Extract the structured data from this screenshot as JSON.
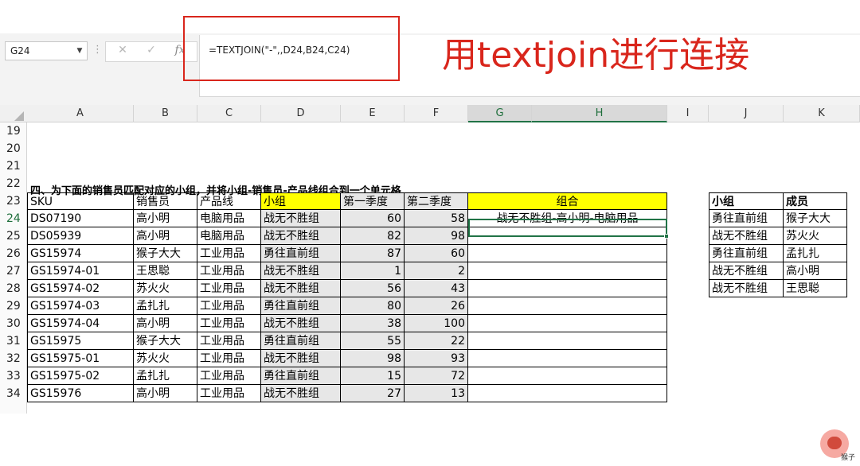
{
  "name_box": "G24",
  "formula": "=TEXTJOIN(\"-\",,D24,B24,C24)",
  "caption": "用textjoin进行连接",
  "columns": [
    "A",
    "B",
    "C",
    "D",
    "E",
    "F",
    "G",
    "H",
    "I",
    "J",
    "K"
  ],
  "row_numbers": [
    "19",
    "20",
    "21",
    "22",
    "23",
    "24",
    "25",
    "26",
    "27",
    "28",
    "29",
    "30",
    "31",
    "32",
    "33",
    "34"
  ],
  "title_row_text": "四、为下面的销售员匹配对应的小组，并将小组-销售员-产品线组合到一个单元格",
  "main_table": {
    "headers": [
      "SKU",
      "销售员",
      "产品线",
      "小组",
      "第一季度",
      "第二季度",
      "组合"
    ],
    "rows": [
      [
        "DS07190",
        "高小明",
        "电脑用品",
        "战无不胜组",
        "60",
        "58",
        "战无不胜组-高小明-电脑用品"
      ],
      [
        "DS05939",
        "高小明",
        "电脑用品",
        "战无不胜组",
        "82",
        "98",
        ""
      ],
      [
        "GS15974",
        "猴子大大",
        "工业用品",
        "勇往直前组",
        "87",
        "60",
        ""
      ],
      [
        "GS15974-01",
        "王思聪",
        "工业用品",
        "战无不胜组",
        "1",
        "2",
        ""
      ],
      [
        "GS15974-02",
        "苏火火",
        "工业用品",
        "战无不胜组",
        "56",
        "43",
        ""
      ],
      [
        "GS15974-03",
        "孟扎扎",
        "工业用品",
        "勇往直前组",
        "80",
        "26",
        ""
      ],
      [
        "GS15974-04",
        "高小明",
        "工业用品",
        "战无不胜组",
        "38",
        "100",
        ""
      ],
      [
        "GS15975",
        "猴子大大",
        "工业用品",
        "勇往直前组",
        "55",
        "22",
        ""
      ],
      [
        "GS15975-01",
        "苏火火",
        "工业用品",
        "战无不胜组",
        "98",
        "93",
        ""
      ],
      [
        "GS15975-02",
        "孟扎扎",
        "工业用品",
        "勇往直前组",
        "15",
        "72",
        ""
      ],
      [
        "GS15976",
        "高小明",
        "工业用品",
        "战无不胜组",
        "27",
        "13",
        ""
      ]
    ]
  },
  "lookup_table": {
    "headers": [
      "小组",
      "成员"
    ],
    "rows": [
      [
        "勇往直前组",
        "猴子大大"
      ],
      [
        "战无不胜组",
        "苏火火"
      ],
      [
        "勇往直前组",
        "孟扎扎"
      ],
      [
        "战无不胜组",
        "高小明"
      ],
      [
        "战无不胜组",
        "王思聪"
      ]
    ]
  },
  "logo_text": "猴子",
  "colors": {
    "accent": "#217346",
    "caption_red": "#d9261c",
    "header_yellow": "#ffff00",
    "number_grey": "#e7e7e7"
  }
}
